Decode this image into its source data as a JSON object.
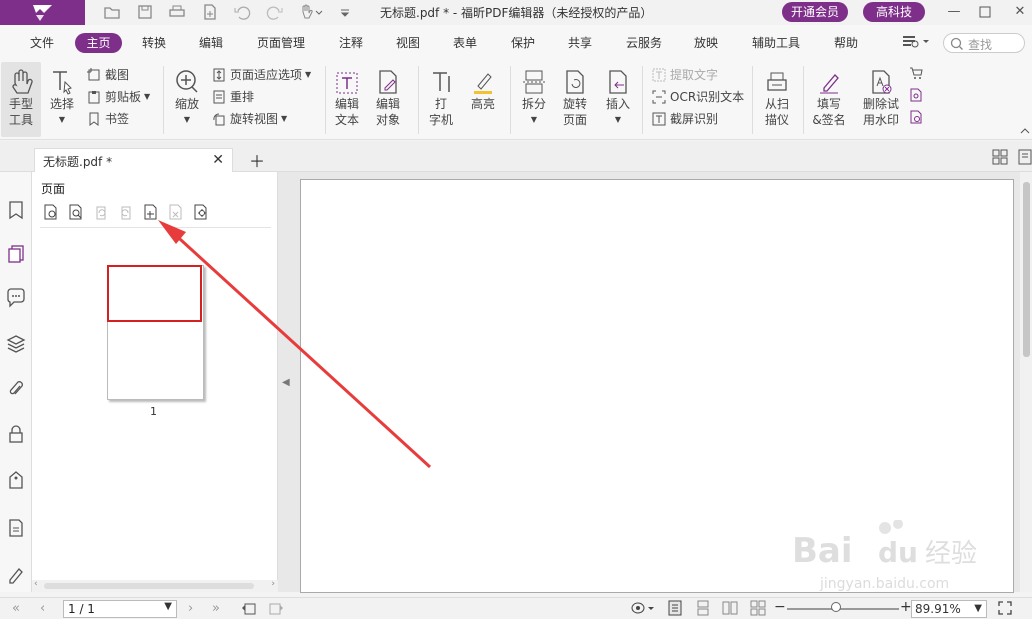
{
  "titlebar": {
    "title": "无标题.pdf * - 福昕PDF编辑器（未经授权的产品）",
    "vip_button": "开通会员",
    "user_button": "高科技"
  },
  "menu": {
    "items": [
      "文件",
      "主页",
      "转换",
      "编辑",
      "页面管理",
      "注释",
      "视图",
      "表单",
      "保护",
      "共享",
      "云服务",
      "放映",
      "辅助工具",
      "帮助"
    ],
    "active": "主页",
    "search_placeholder": "查找"
  },
  "ribbon": {
    "hand_tool": "手型\n工具",
    "select": "选择",
    "screenshot": "截图",
    "clipboard": "剪贴板",
    "bookmark": "书签",
    "zoom": "缩放",
    "page_fit": "页面适应选项",
    "reflow": "重排",
    "rotate_view": "旋转视图",
    "edit_text": "编辑\n文本",
    "edit_object": "编辑\n对象",
    "typewriter": "打\n字机",
    "highlight": "高亮",
    "split": "拆分",
    "rotate_page": "旋转\n页面",
    "insert": "插入",
    "extract_text": "提取文字",
    "ocr": "OCR识别文本",
    "screen_ocr": "截屏识别",
    "from_scanner": "从扫\n描仪",
    "fill_sign": "填写\n&签名",
    "remove_watermark": "删除试\n用水印"
  },
  "tabs": {
    "doc_tab": "无标题.pdf *"
  },
  "pages_panel": {
    "title": "页面",
    "thumb_number": "1"
  },
  "status": {
    "page_value": "1 / 1",
    "zoom_value": "89.91%"
  },
  "watermark": {
    "brand": "Baidu 经验",
    "url": "jingyan.baidu.com"
  },
  "colors": {
    "brand_purple": "#7d2f8a",
    "selection_red": "#d42020",
    "arrow_red": "#e83b3b"
  }
}
